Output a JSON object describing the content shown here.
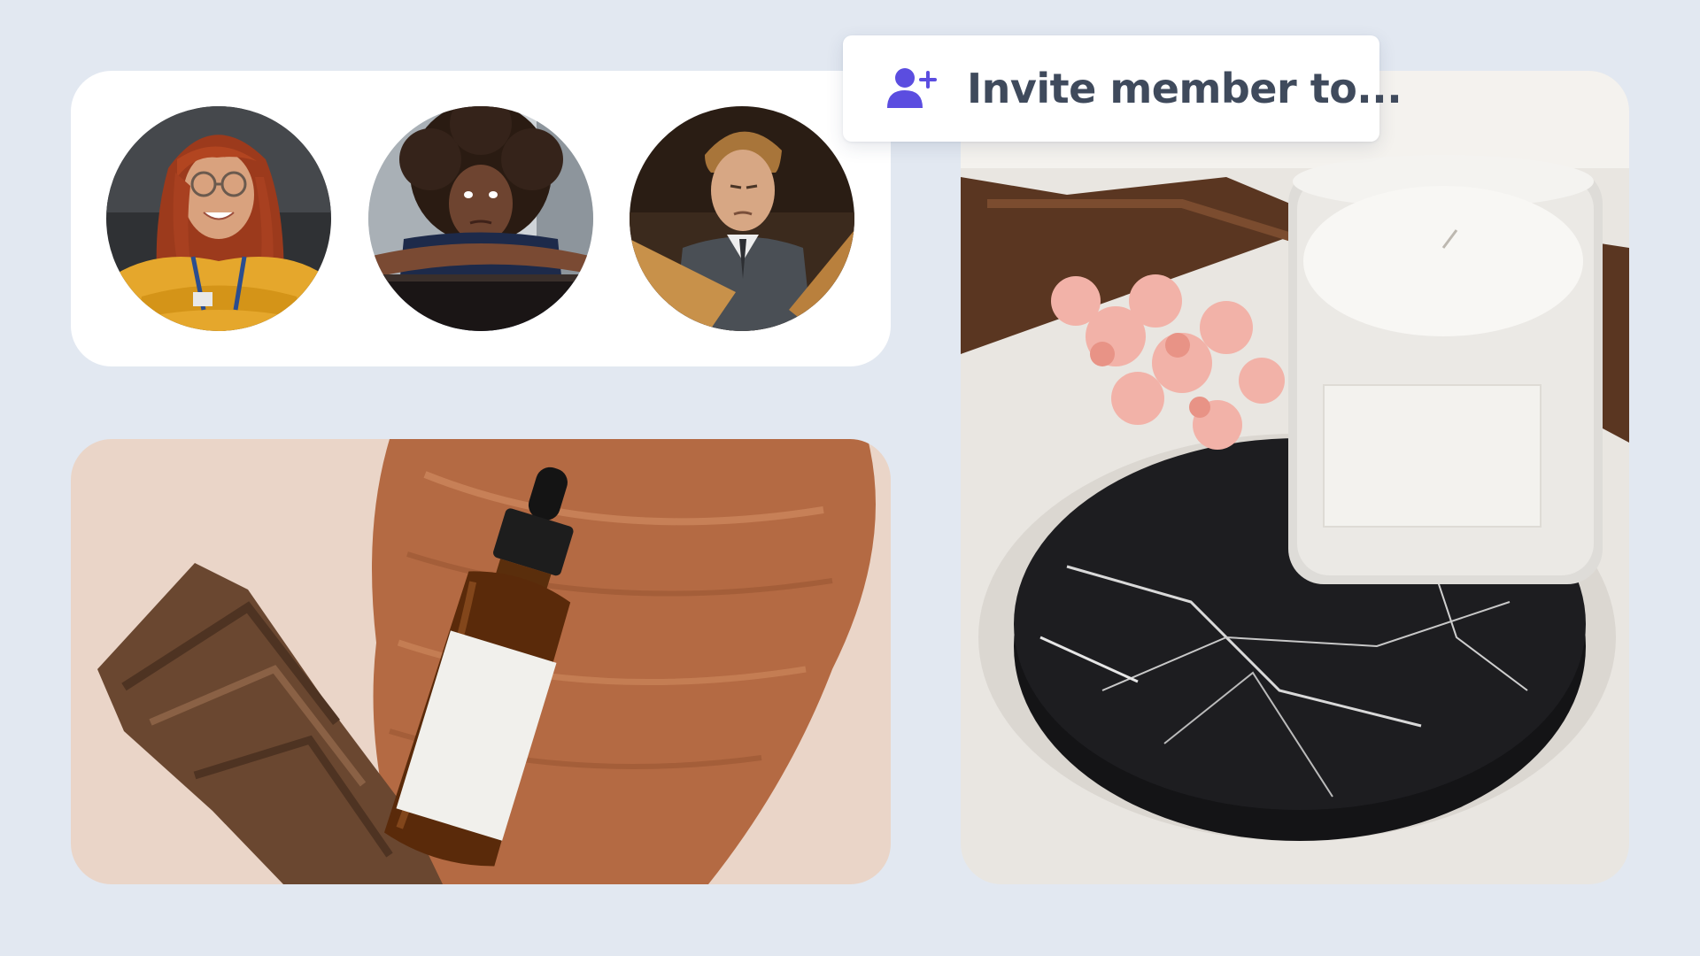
{
  "colors": {
    "background": "#e2e8f1",
    "card": "#ffffff",
    "accent": "#5b4de0",
    "invite_text": "#3f4a5c"
  },
  "members": [
    {
      "avatar": "member-avatar-woman-red-hair-glasses"
    },
    {
      "avatar": "member-avatar-woman-curly-hair"
    },
    {
      "avatar": "member-avatar-man-suit"
    }
  ],
  "invite": {
    "icon": "user-plus-icon",
    "label": "Invite member to..."
  },
  "photos": [
    {
      "subject": "dropper-bottle-on-wood"
    },
    {
      "subject": "candle-on-marble-coaster"
    }
  ]
}
